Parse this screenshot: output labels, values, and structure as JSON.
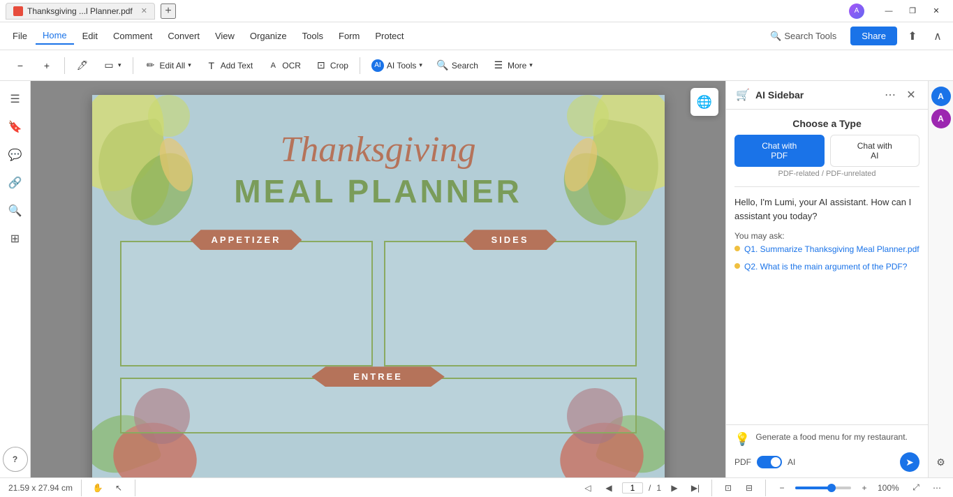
{
  "titleBar": {
    "tabLabel": "Thanksgiving ...l Planner.pdf",
    "newTabLabel": "+",
    "avatarText": "A",
    "winMinimize": "—",
    "winRestore": "❐",
    "winClose": "✕"
  },
  "menuBar": {
    "items": [
      "File",
      "Home",
      "Edit",
      "Comment",
      "Convert",
      "View",
      "Organize",
      "Tools",
      "Form",
      "Protect"
    ],
    "activeItem": "Home",
    "searchToolsLabel": "Search Tools",
    "shareLabel": "Share",
    "uploadIcon": "⬆",
    "collapseIcon": "∧"
  },
  "toolbar": {
    "zoomOut": "−",
    "zoomIn": "+",
    "highlight": "🖊",
    "shape": "▭",
    "editAll": "Edit All",
    "addText": "Add Text",
    "ocr": "OCR",
    "crop": "Crop",
    "aiTools": "AI Tools",
    "search": "Search",
    "more": "More"
  },
  "leftSidebar": {
    "icons": [
      {
        "name": "thumbnail-icon",
        "glyph": "☰",
        "label": "Thumbnails"
      },
      {
        "name": "bookmark-icon",
        "glyph": "🔖",
        "label": "Bookmarks"
      },
      {
        "name": "comment-icon",
        "glyph": "💬",
        "label": "Comments"
      },
      {
        "name": "link-icon",
        "glyph": "🔗",
        "label": "Links"
      },
      {
        "name": "search-icon",
        "glyph": "🔍",
        "label": "Search"
      },
      {
        "name": "layers-icon",
        "glyph": "⊞",
        "label": "Layers"
      },
      {
        "name": "help-icon",
        "glyph": "?",
        "label": "Help"
      }
    ]
  },
  "pdfDoc": {
    "title": "Thanksgiving",
    "subtitle": "MEAL PLANNER",
    "sections": [
      {
        "name": "APPETIZER"
      },
      {
        "name": "SIDES"
      },
      {
        "name": "ENTREE"
      }
    ],
    "decorColors": {
      "banner": "#b5735a",
      "border": "#8aaa60",
      "bg": "#b3cdd6",
      "leaf1": "#c5d060",
      "leaf2": "#6aaa70",
      "leaf3": "#c87060",
      "leaf4": "#a06090"
    }
  },
  "statusBar": {
    "dimensions": "21.59 x 27.94 cm",
    "handIcon": "✋",
    "pointerIcon": "↖",
    "prevPage": "◀",
    "firstPage": "◁◁",
    "nextPage": "▶",
    "lastPage": "▶▶",
    "currentPage": "1",
    "totalPages": "1",
    "zoomOutIcon": "−",
    "zoomInIcon": "+",
    "zoomLevel": "100%",
    "fitIcon": "⊡",
    "moreIcon": "⋯"
  },
  "aiSidebar": {
    "title": "AI Sidebar",
    "cartIcon": "🛒",
    "moreIcon": "⋯",
    "closeIcon": "✕",
    "settingsIcon": "⚙",
    "chooseTypeLabel": "Choose a Type",
    "chatWithPDFLabel": "Chat with\nPDF",
    "chatWithAILabel": "Chat with\nAI",
    "pdfRelatedLabel": "PDF-related / PDF-unrelated",
    "greetingText": "Hello, I'm Lumi, your AI assistant. How can I assistant you today?",
    "youMayAskLabel": "You may ask:",
    "suggestions": [
      {
        "text": "Q1. Summarize Thanksgiving Meal Planner.pdf"
      },
      {
        "text": "Q2. What is the main argument of the PDF?"
      }
    ],
    "promptPlaceholder": "Generate a food menu for my restaurant.",
    "pdfToggleLabel": "PDF",
    "aiToggleLabel": "AI",
    "sendIcon": "➤"
  },
  "rightSidebar": {
    "icons": [
      {
        "name": "avatar-a-icon",
        "glyph": "A",
        "color": "#1a73e8"
      },
      {
        "name": "avatar-b-icon",
        "glyph": "A",
        "color": "#9c27b0"
      }
    ]
  }
}
